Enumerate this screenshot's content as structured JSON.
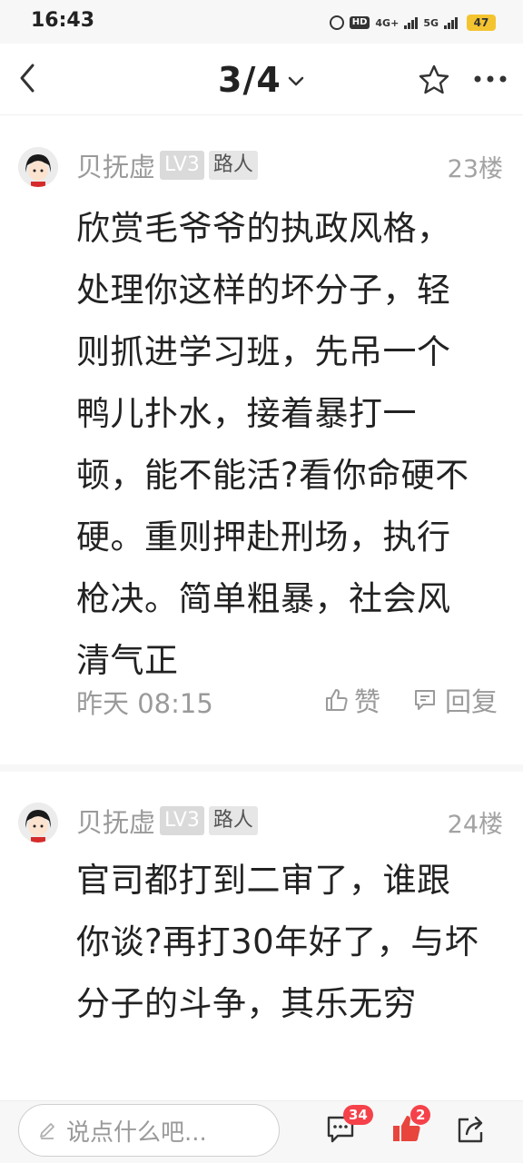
{
  "status_bar": {
    "time": "16:43",
    "hd_label": "HD",
    "net1": "4G+",
    "net2": "5G",
    "battery": "47"
  },
  "nav": {
    "page_indicator": "3/4",
    "icons": [
      "back-icon",
      "chevron-down-icon",
      "star-icon",
      "more-icon"
    ]
  },
  "comments": [
    {
      "author": "贝抚虚",
      "level": "LV3",
      "tag": "路人",
      "floor": "23楼",
      "text": "欣赏毛爷爷的执政风格，处理你这样的坏分子，轻则抓进学习班，先吊一个鸭儿扑水，接着暴打一顿，能不能活?看你命硬不硬。重则押赴刑场，执行枪决。简单粗暴，社会风清气正",
      "time": "昨天 08:15",
      "like_label": "赞",
      "reply_label": "回复"
    },
    {
      "author": "贝抚虚",
      "level": "LV3",
      "tag": "路人",
      "floor": "24楼",
      "text": "官司都打到二审了，谁跟你谈?再打30年好了，与坏分子的斗争，其乐无穷"
    }
  ],
  "bottom_bar": {
    "input_placeholder": "说点什么吧...",
    "comments_count": "34",
    "likes_count": "2"
  },
  "colors": {
    "accent_red": "#f5424a",
    "text_primary": "#222222",
    "text_secondary": "#9a9a9a"
  }
}
